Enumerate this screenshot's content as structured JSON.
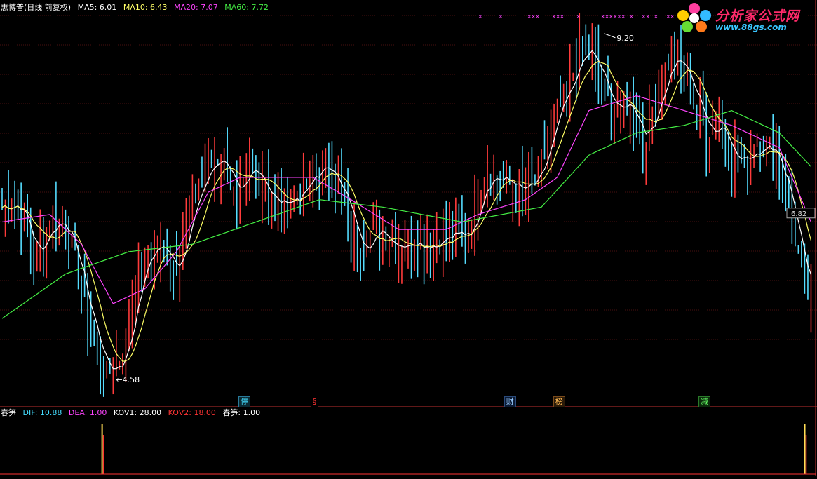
{
  "main_legend": {
    "title": "惠博普(日线 前复权)",
    "items": [
      {
        "label": "MA5: 6.01",
        "color": "#ffffff"
      },
      {
        "label": "MA10: 6.43",
        "color": "#ffff66"
      },
      {
        "label": "MA20: 7.07",
        "color": "#ff44ff"
      },
      {
        "label": "MA60: 7.72",
        "color": "#44ee44"
      }
    ]
  },
  "sub_legend": {
    "title": "春笋",
    "items": [
      {
        "label": "DIF: 10.88",
        "color": "#44ddff"
      },
      {
        "label": "DEA: 1.00",
        "color": "#ff44ff"
      },
      {
        "label": "KOV1: 28.00",
        "color": "#ffffff"
      },
      {
        "label": "KOV2: 18.00",
        "color": "#ff3333"
      },
      {
        "label": "春笋: 1.00",
        "color": "#ffffff"
      }
    ]
  },
  "logo": {
    "title": "分析家公式网",
    "url": "www.88gs.com"
  },
  "annotations": {
    "high": "9.20",
    "low": "4.58",
    "price_tag": "6.82"
  },
  "badges": [
    {
      "text": "停",
      "color": "#44ddff",
      "border": "#2a7a9a",
      "bg": "#0b2a33",
      "pos": 0.292
    },
    {
      "text": "§",
      "color": "#ff3333",
      "border": "#000000",
      "bg": "#000000",
      "pos": 0.38
    },
    {
      "text": "财",
      "color": "#99ccff",
      "border": "#2a4a7a",
      "bg": "#0b1a33",
      "pos": 0.617
    },
    {
      "text": "榜",
      "color": "#ffbb55",
      "border": "#7a4a1a",
      "bg": "#2a1a08",
      "pos": 0.677
    },
    {
      "text": "减",
      "color": "#66ff66",
      "border": "#2a7a2a",
      "bg": "#0b2a0b",
      "pos": 0.855
    }
  ],
  "chart_data": {
    "type": "candlestick",
    "series": [
      {
        "name": "MA5"
      },
      {
        "name": "MA10"
      },
      {
        "name": "MA20"
      },
      {
        "name": "MA60"
      }
    ],
    "price_range": [
      4.4,
      9.5
    ],
    "close_points": [
      [
        0,
        6.9
      ],
      [
        5,
        7.0
      ],
      [
        10,
        6.2
      ],
      [
        15,
        6.7
      ],
      [
        20,
        6.7
      ],
      [
        26,
        5.6
      ],
      [
        30,
        5.0
      ],
      [
        33,
        4.65
      ],
      [
        38,
        4.9
      ],
      [
        42,
        5.8
      ],
      [
        46,
        6.3
      ],
      [
        50,
        6.4
      ],
      [
        54,
        6.1
      ],
      [
        58,
        6.6
      ],
      [
        62,
        7.2
      ],
      [
        66,
        7.5
      ],
      [
        70,
        7.6
      ],
      [
        74,
        6.9
      ],
      [
        78,
        7.4
      ],
      [
        82,
        7.3
      ],
      [
        86,
        6.9
      ],
      [
        90,
        7.0
      ],
      [
        94,
        7.1
      ],
      [
        98,
        7.3
      ],
      [
        102,
        7.5
      ],
      [
        106,
        7.2
      ],
      [
        110,
        6.6
      ],
      [
        114,
        6.4
      ],
      [
        118,
        6.6
      ],
      [
        122,
        6.5
      ],
      [
        126,
        6.4
      ],
      [
        130,
        6.5
      ],
      [
        134,
        6.4
      ],
      [
        138,
        6.5
      ],
      [
        142,
        6.5
      ],
      [
        146,
        6.5
      ],
      [
        148,
        6.7
      ],
      [
        152,
        7.4
      ],
      [
        156,
        7.3
      ],
      [
        160,
        7.2
      ],
      [
        166,
        7.1
      ],
      [
        170,
        7.4
      ],
      [
        174,
        8.1
      ],
      [
        178,
        8.4
      ],
      [
        182,
        9.0
      ],
      [
        186,
        8.9
      ],
      [
        190,
        8.4
      ],
      [
        194,
        8.2
      ],
      [
        198,
        8.3
      ],
      [
        202,
        7.8
      ],
      [
        206,
        8.3
      ],
      [
        210,
        8.9
      ],
      [
        214,
        8.8
      ],
      [
        218,
        8.4
      ],
      [
        222,
        7.9
      ],
      [
        226,
        8.1
      ],
      [
        230,
        7.6
      ],
      [
        234,
        7.5
      ],
      [
        238,
        7.8
      ],
      [
        242,
        7.7
      ],
      [
        244,
        7.6
      ],
      [
        248,
        7.0
      ],
      [
        252,
        6.0
      ],
      [
        256,
        5.5
      ]
    ],
    "ma60_points": [
      [
        0,
        5.4
      ],
      [
        20,
        6.0
      ],
      [
        40,
        6.3
      ],
      [
        60,
        6.4
      ],
      [
        80,
        6.7
      ],
      [
        100,
        7.0
      ],
      [
        120,
        6.9
      ],
      [
        145,
        6.7
      ],
      [
        170,
        6.9
      ],
      [
        185,
        7.6
      ],
      [
        200,
        7.9
      ],
      [
        215,
        8.0
      ],
      [
        230,
        8.2
      ],
      [
        245,
        7.9
      ],
      [
        256,
        7.4
      ]
    ],
    "ma20_points": [
      [
        0,
        6.7
      ],
      [
        15,
        6.8
      ],
      [
        25,
        6.4
      ],
      [
        35,
        5.6
      ],
      [
        45,
        5.8
      ],
      [
        55,
        6.3
      ],
      [
        65,
        7.1
      ],
      [
        75,
        7.3
      ],
      [
        85,
        7.3
      ],
      [
        98,
        7.3
      ],
      [
        110,
        7.0
      ],
      [
        125,
        6.6
      ],
      [
        140,
        6.6
      ],
      [
        150,
        6.8
      ],
      [
        165,
        7.0
      ],
      [
        175,
        7.3
      ],
      [
        185,
        8.2
      ],
      [
        200,
        8.4
      ],
      [
        215,
        8.2
      ],
      [
        230,
        8.0
      ],
      [
        245,
        7.7
      ],
      [
        256,
        6.6
      ]
    ],
    "marks": {
      "high": 9.2,
      "low": 4.58,
      "price_tag": 6.82
    },
    "spike_positions": [
      0.125,
      0.985
    ],
    "tick_range": [
      0,
      256
    ]
  }
}
